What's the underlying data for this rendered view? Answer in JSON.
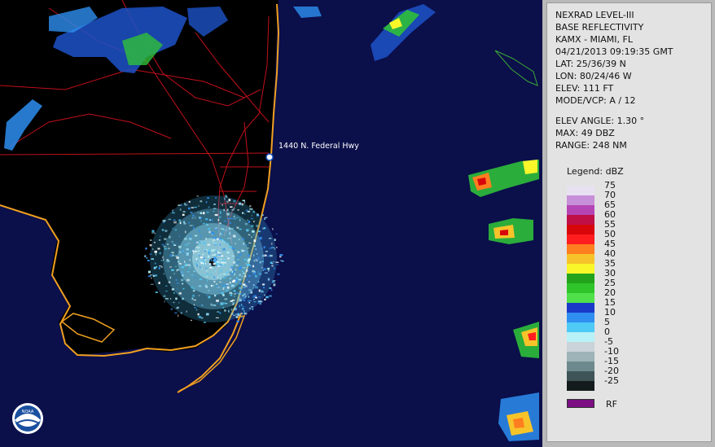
{
  "info": {
    "product": "NEXRAD LEVEL-III",
    "product_type": "BASE REFLECTIVITY",
    "station": "KAMX - MIAMI, FL",
    "datetime": "04/21/2013 09:19:35 GMT",
    "lat": "LAT: 25/36/39 N",
    "lon": "LON: 80/24/46 W",
    "elev": "ELEV: 111 FT",
    "mode": "MODE/VCP: A / 12",
    "elev_angle": "ELEV ANGLE: 1.30 °",
    "max": "MAX: 49 DBZ",
    "range": "RANGE: 248 NM"
  },
  "legend": {
    "title": "Legend: dBZ",
    "levels": [
      {
        "label": "75",
        "color": "#e8e1f1"
      },
      {
        "label": "70",
        "color": "#c78fd7"
      },
      {
        "label": "65",
        "color": "#b545b4"
      },
      {
        "label": "60",
        "color": "#c00f47"
      },
      {
        "label": "55",
        "color": "#d8060b"
      },
      {
        "label": "50",
        "color": "#ff1d20"
      },
      {
        "label": "45",
        "color": "#ff7e1f"
      },
      {
        "label": "40",
        "color": "#f6c42a"
      },
      {
        "label": "35",
        "color": "#f9f62a"
      },
      {
        "label": "30",
        "color": "#23a31c"
      },
      {
        "label": "25",
        "color": "#2fc52a"
      },
      {
        "label": "20",
        "color": "#4fe04a"
      },
      {
        "label": "15",
        "color": "#1a39c9"
      },
      {
        "label": "10",
        "color": "#2f8ef0"
      },
      {
        "label": "5",
        "color": "#4fc9f5"
      },
      {
        "label": "0",
        "color": "#b8f1f7"
      },
      {
        "label": "-5",
        "color": "#c9d3d8"
      },
      {
        "label": "-10",
        "color": "#9db3b8"
      },
      {
        "label": "-15",
        "color": "#6c8a8d"
      },
      {
        "label": "-20",
        "color": "#3f5456"
      },
      {
        "label": "-25",
        "color": "#141b1c"
      }
    ],
    "rf_label": "RF",
    "rf_color": "#7b0e83"
  },
  "map": {
    "marker_label": "1440 N. Federal Hwy",
    "logo": "noaa-logo"
  }
}
